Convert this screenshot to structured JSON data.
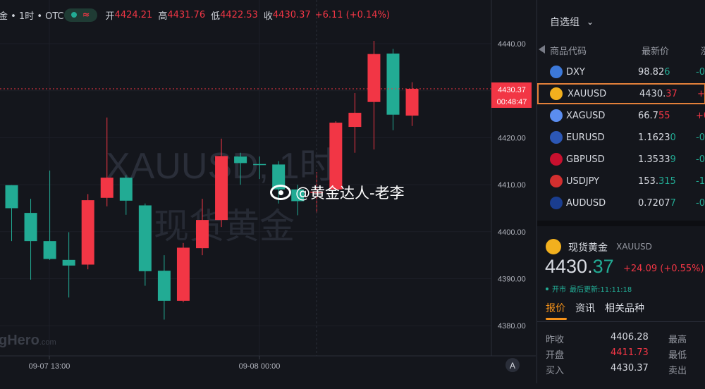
{
  "header": {
    "symbol_title": "金 • 1时 • OTC",
    "approx_icon": "≈",
    "open_label": "开",
    "open": "4424.21",
    "high_label": "高",
    "high": "4431.76",
    "low_label": "低",
    "low": "4422.53",
    "close_label": "收",
    "close": "4430.37",
    "change": "+6.11 (+0.14%)"
  },
  "colors": {
    "up": "#f23645",
    "down": "#22ab94",
    "accent": "#f7931a",
    "background": "#14161c"
  },
  "watermark": {
    "line1": "XAUUSD, 1时",
    "line2": "现货黄金",
    "overlay": "@黄金达人-老李",
    "brand": "gHero",
    "brand_suffix": ".com"
  },
  "chart_data": {
    "type": "candlestick",
    "title": "",
    "x_ticks": [
      "09-07 13:00",
      "09-08 00:00"
    ],
    "y_ticks": [
      "4440.00",
      "4430.00",
      "4420.00",
      "4410.00",
      "4400.00",
      "4390.00",
      "4380.00"
    ],
    "last_price_label": "4430.37",
    "countdown_label": "00:48:47",
    "ylim": [
      4376,
      4443
    ],
    "candles": [
      {
        "o": 4409.9,
        "h": 4409.9,
        "l": 4398.0,
        "c": 4405.0
      },
      {
        "o": 4404.0,
        "h": 4407.0,
        "l": 4389.8,
        "c": 4398.0
      },
      {
        "o": 4398.0,
        "h": 4413.0,
        "l": 4394.0,
        "c": 4394.2
      },
      {
        "o": 4394.0,
        "h": 4399.9,
        "l": 4386.0,
        "c": 4392.8
      },
      {
        "o": 4393.0,
        "h": 4408.0,
        "l": 4392.0,
        "c": 4406.7
      },
      {
        "o": 4407.2,
        "h": 4424.3,
        "l": 4405.4,
        "c": 4411.5
      },
      {
        "o": 4411.5,
        "h": 4412.0,
        "l": 4403.6,
        "c": 4406.6
      },
      {
        "o": 4405.6,
        "h": 4406.0,
        "l": 4388.5,
        "c": 4391.6
      },
      {
        "o": 4391.7,
        "h": 4395.0,
        "l": 4381.3,
        "c": 4385.3
      },
      {
        "o": 4385.3,
        "h": 4397.6,
        "l": 4385.0,
        "c": 4396.6
      },
      {
        "o": 4396.5,
        "h": 4407.0,
        "l": 4395.0,
        "c": 4402.5
      },
      {
        "o": 4402.5,
        "h": 4419.8,
        "l": 4401.0,
        "c": 4416.1
      },
      {
        "o": 4416.0,
        "h": 4416.8,
        "l": 4410.0,
        "c": 4414.6
      },
      {
        "o": 4414.4,
        "h": 4416.0,
        "l": 4411.2,
        "c": 4414.3
      },
      {
        "o": 4414.3,
        "h": 4415.0,
        "l": 4406.0,
        "c": 4409.0
      },
      {
        "o": 4409.0,
        "h": 4410.0,
        "l": 4403.5,
        "c": 4406.5
      },
      {
        "o": 4408.5,
        "h": 4412.7,
        "l": 4404.0,
        "c": 4408.5
      },
      {
        "o": 4409.0,
        "h": 4423.5,
        "l": 4409.0,
        "c": 4423.2
      },
      {
        "o": 4422.3,
        "h": 4429.5,
        "l": 4416.8,
        "c": 4425.3
      },
      {
        "o": 4427.6,
        "h": 4440.6,
        "l": 4417.5,
        "c": 4437.8
      },
      {
        "o": 4437.9,
        "h": 4438.9,
        "l": 4421.6,
        "c": 4424.9
      },
      {
        "o": 4424.7,
        "h": 4431.8,
        "l": 4422.5,
        "c": 4430.4
      }
    ]
  },
  "watchlist": {
    "title": "自选组",
    "cols": [
      "商品代码",
      "最新价",
      "涨"
    ],
    "rows": [
      {
        "sym": "DXY",
        "price": "98.82",
        "frac": "6",
        "chg": "-0.",
        "dir": "down",
        "flag": "#3c78d8"
      },
      {
        "sym": "XAUUSD",
        "price": "4430.",
        "frac": "37",
        "chg": "+24",
        "dir": "up",
        "flag": "#f2b01e"
      },
      {
        "sym": "XAGUSD",
        "price": "66.7",
        "frac": "55",
        "chg": "+0.",
        "dir": "up",
        "flag": "#5b8def"
      },
      {
        "sym": "EURUSD",
        "price": "1.1623",
        "frac": "0",
        "chg": "-0.00",
        "dir": "down",
        "flag": "#2c57b5"
      },
      {
        "sym": "GBPUSD",
        "price": "1.3533",
        "frac": "9",
        "chg": "-0.00",
        "dir": "down",
        "flag": "#c8102e"
      },
      {
        "sym": "USDJPY",
        "price": "153.",
        "frac": "315",
        "chg": "-1.",
        "dir": "down",
        "flag": "#d32f2f"
      },
      {
        "sym": "AUDUSD",
        "price": "0.7207",
        "frac": "7",
        "chg": "-0.00",
        "dir": "down",
        "flag": "#1a3d8f"
      }
    ]
  },
  "detail": {
    "name": "现货黄金",
    "symbol": "XAUUSD",
    "price_main": "4430.",
    "price_frac": "37",
    "change": "+24.09 (+0.55%)",
    "status": "开市",
    "updated": "最后更新:11:11:18",
    "tabs": [
      "报价",
      "资讯",
      "相关品种"
    ],
    "quotes": [
      {
        "label": "昨收",
        "value": "4406.28",
        "label2": "最高",
        "color": "#d8dbe2"
      },
      {
        "label": "开盘",
        "value": "4411.73",
        "label2": "最低",
        "color": "#f23645"
      },
      {
        "label": "买入",
        "value": "4430.37",
        "label2": "卖出",
        "color": "#d8dbe2"
      }
    ]
  }
}
